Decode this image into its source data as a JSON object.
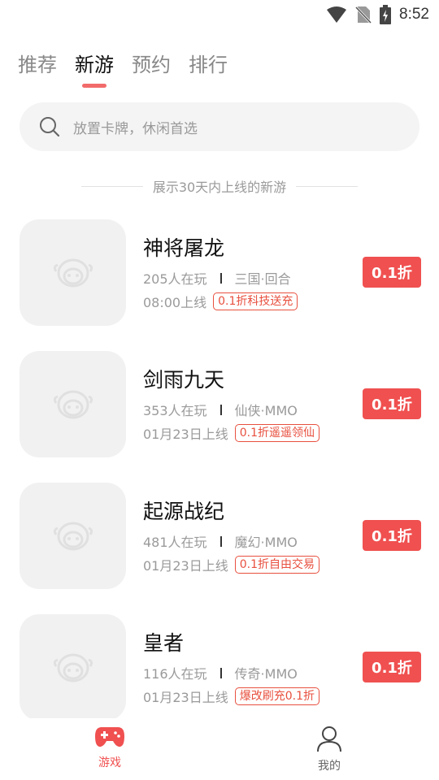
{
  "status_bar": {
    "time": "8:52",
    "icons": [
      "wifi-icon",
      "no-sim-icon",
      "battery-charging-icon"
    ]
  },
  "tabs": [
    {
      "label": "推荐",
      "active": false
    },
    {
      "label": "新游",
      "active": true
    },
    {
      "label": "预约",
      "active": false
    },
    {
      "label": "排行",
      "active": false
    }
  ],
  "search": {
    "placeholder": "放置卡牌，休闲首选",
    "icon": "search-icon"
  },
  "section_note": "展示30天内上线的新游",
  "games": [
    {
      "name": "神将屠龙",
      "players": "205人在玩",
      "genre": "三国·回合",
      "launch": "08:00上线",
      "tag": "0.1折科技送充",
      "discount": "0.1折"
    },
    {
      "name": "剑雨九天",
      "players": "353人在玩",
      "genre": "仙侠·MMO",
      "launch": "01月23日上线",
      "tag": "0.1折遥遥领仙",
      "discount": "0.1折"
    },
    {
      "name": "起源战纪",
      "players": "481人在玩",
      "genre": "魔幻·MMO",
      "launch": "01月23日上线",
      "tag": "0.1折自由交易",
      "discount": "0.1折"
    },
    {
      "name": "皇者",
      "players": "116人在玩",
      "genre": "传奇·MMO",
      "launch": "01月23日上线",
      "tag": "爆改刷充0.1折",
      "discount": "0.1折"
    }
  ],
  "bottom_nav": [
    {
      "label": "游戏",
      "icon": "gamepad-icon",
      "active": true
    },
    {
      "label": "我的",
      "icon": "profile-icon",
      "active": false
    }
  ],
  "colors": {
    "accent": "#f05050",
    "tab_indicator": "#f26b6b",
    "tag_border": "#e8503f"
  }
}
